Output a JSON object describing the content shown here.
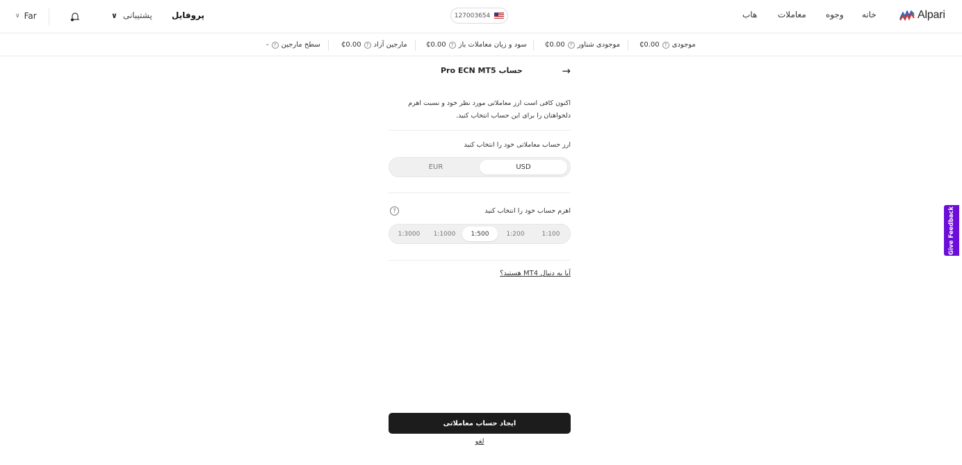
{
  "nav": {
    "language": "Far",
    "support": "پشتیبانی",
    "profile": "پروفایل",
    "account_number": "127003654",
    "links": [
      "هاب",
      "معاملات",
      "وجوه",
      "خانه"
    ],
    "logo_text": "Alpari",
    "accent": "#6b0fd8"
  },
  "stats": {
    "balance_label": "موجودی",
    "balance_value": "₵0.00",
    "floating_label": "موجودی شناور",
    "floating_value": "₵0.00",
    "pnl_label": "سود و زیان معاملات باز",
    "pnl_value": "₵0.00",
    "free_margin_label": "مارجین آزاد",
    "free_margin_value": "₵0.00",
    "margin_level_label": "سطح مارجین",
    "margin_level_value": "-"
  },
  "form": {
    "title": "حساب Pro ECN MT5",
    "intro": "اکنون کافی است ارز معاملاتی مورد نظر خود و نسبت اهرم دلخواهتان را برای این حساب انتخاب کنید.",
    "currency_label": "ارز حساب معاملاتی خود را انتخاب کنید",
    "currencies": [
      "EUR",
      "USD"
    ],
    "selected_currency": "USD",
    "leverage_label": "اهرم حساب خود را انتخاب کنید",
    "leverages": [
      "1:3000",
      "1:1000",
      "1:500",
      "1:200",
      "1:100"
    ],
    "selected_leverage": "1:500",
    "mt4_link": "آیا به دنبال MT4 هستید؟",
    "create_button": "ایجاد حساب معاملاتی",
    "cancel": "لغو"
  },
  "feedback": {
    "label": "Give Feedback"
  }
}
